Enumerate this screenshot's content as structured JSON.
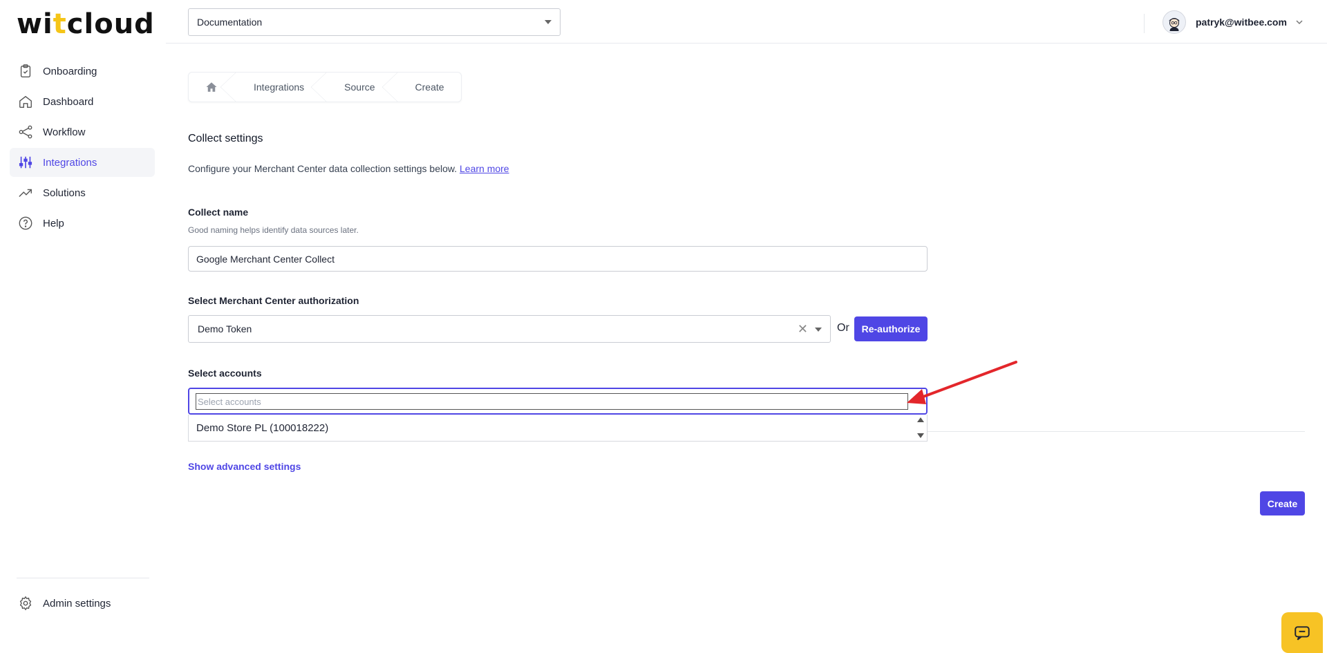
{
  "brand": {
    "logo_pre": "wi",
    "logo_t": "t",
    "logo_post": "cloud",
    "accent": "#4f46e5",
    "logo_accent": "#f5c518"
  },
  "sidebar": {
    "items": [
      {
        "label": "Onboarding",
        "icon": "clipboard-check-icon"
      },
      {
        "label": "Dashboard",
        "icon": "home-icon"
      },
      {
        "label": "Workflow",
        "icon": "share-nodes-icon"
      },
      {
        "label": "Integrations",
        "icon": "sliders-icon",
        "active": true
      },
      {
        "label": "Solutions",
        "icon": "trending-up-icon"
      },
      {
        "label": "Help",
        "icon": "question-circle-icon"
      }
    ],
    "admin_label": "Admin settings"
  },
  "topbar": {
    "project": "Documentation",
    "user_email": "patryk@witbee.com"
  },
  "breadcrumb": {
    "items": [
      "Integrations",
      "Source",
      "Create"
    ]
  },
  "form": {
    "section_title": "Collect settings",
    "description": "Configure your Merchant Center data collection settings below.",
    "learn_more": "Learn more",
    "collect_name_label": "Collect name",
    "collect_name_help": "Good naming helps identify data sources later.",
    "collect_name_value": "Google Merchant Center Collect",
    "auth_label": "Select Merchant Center authorization",
    "auth_value": "Demo Token",
    "or_text": "Or",
    "reauthorize": "Re-authorize",
    "accounts_label": "Select accounts",
    "accounts_placeholder": "Select accounts",
    "accounts_options": [
      "Demo Store PL (100018222)"
    ],
    "advanced_link": "Show advanced settings",
    "create": "Create"
  }
}
